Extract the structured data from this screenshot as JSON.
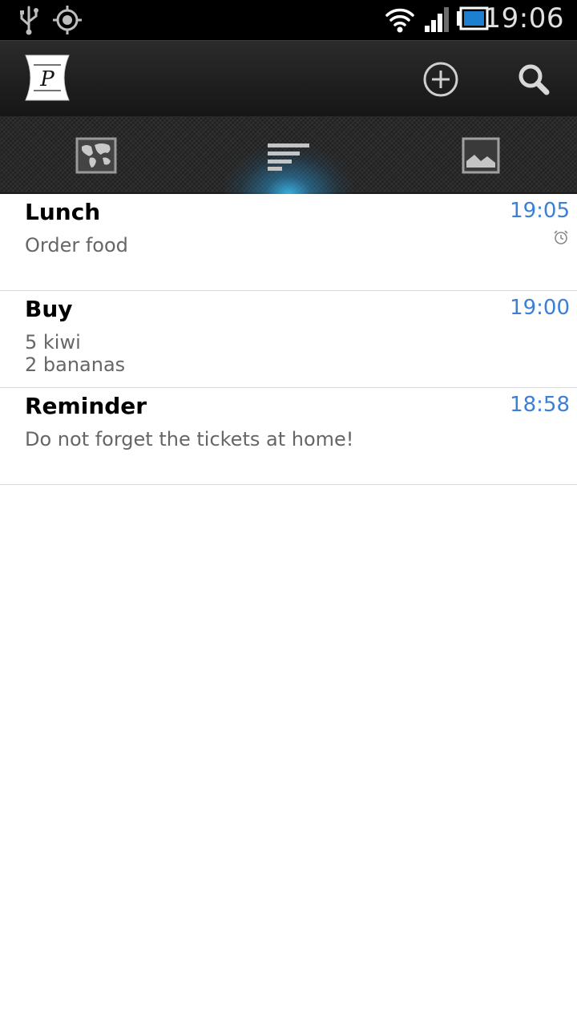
{
  "status_bar": {
    "time": "19:06",
    "icons": [
      "usb-icon",
      "gps-icon",
      "wifi-icon",
      "signal-icon",
      "battery-icon"
    ]
  },
  "action_bar": {
    "logo_letter": "P",
    "actions": [
      "add-circle-icon",
      "search-icon"
    ]
  },
  "tabs": [
    {
      "icon": "map-icon",
      "selected": false
    },
    {
      "icon": "list-icon",
      "selected": true
    },
    {
      "icon": "image-icon",
      "selected": false
    }
  ],
  "colors": {
    "accent_time": "#3d7fd6",
    "tab_glow": "#35b4e6"
  },
  "notes": [
    {
      "title": "Lunch",
      "body": "Order food",
      "time": "19:05",
      "alarm": true
    },
    {
      "title": "Buy",
      "body": "5 kiwi\n2 bananas",
      "time": "19:00",
      "alarm": false
    },
    {
      "title": "Reminder",
      "body": "Do not forget the tickets at home!",
      "time": "18:58",
      "alarm": false
    }
  ]
}
